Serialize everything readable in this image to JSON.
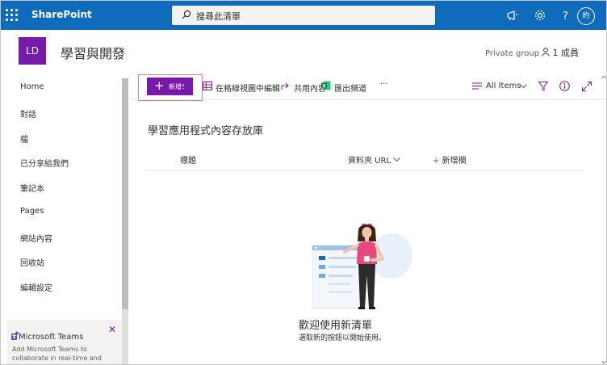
{
  "suite": {
    "app_name": "SharePoint",
    "search_placeholder": "搜尋此清單",
    "user_initials": "約"
  },
  "site": {
    "logo_initials": "LD",
    "title": "學習與開發",
    "privacy": "Private group",
    "members_label": "1 成員"
  },
  "nav": {
    "items": [
      "Home",
      "對話",
      "檔",
      "已分享給我們",
      "筆記本",
      "Pages",
      "網站內容",
      "回收站",
      "編輯設定"
    ]
  },
  "teams": {
    "title": "Microsoft Teams",
    "description": "Add Microsoft Teams to collaborate in real-time and"
  },
  "commands": {
    "new_label": "新增！",
    "edit_grid": "在格線視圖中編輯",
    "share": "共用內容",
    "export": "匯出頻道",
    "more": "···",
    "view": "All Items"
  },
  "list": {
    "title": "學習應用程式內容存放庫",
    "columns": [
      "標題",
      "資料夾 URL",
      "新增欄"
    ],
    "welcome_title": "歡迎使用新清單",
    "welcome_sub": "選取新的按鈕以開始使用。"
  },
  "colors": {
    "suite_blue": "#0f6cbd",
    "accent_purple": "#7719aa",
    "highlight_red": "#e37d80"
  }
}
